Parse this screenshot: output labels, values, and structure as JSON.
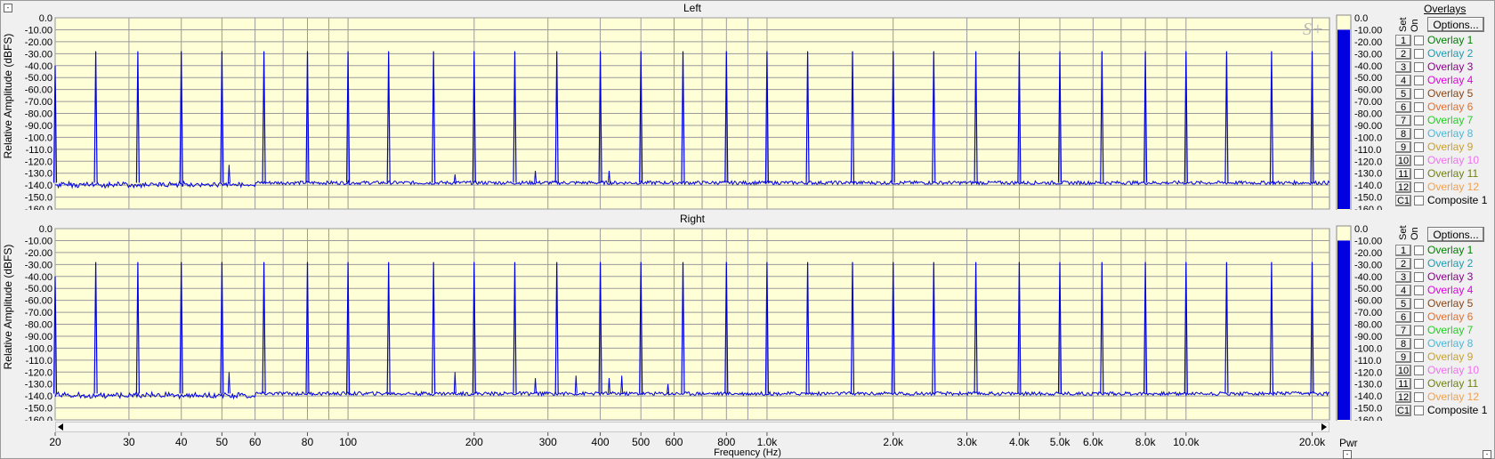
{
  "window": {
    "corner_tl": "-",
    "corner_br": "-",
    "corner_bl": "-"
  },
  "panels": [
    {
      "title": "Left"
    },
    {
      "title": "Right"
    }
  ],
  "ylabel": "Relative Amplitude (dBFS)",
  "xlabel": "Frequency (Hz)",
  "logo": "S+",
  "pwr_label": "Pwr",
  "overlays": {
    "header": "Overlays",
    "set_label": "Set",
    "on_label": "On",
    "options_label": "Options...",
    "items": [
      {
        "set": "1",
        "label": "Overlay 1",
        "color": "#008000"
      },
      {
        "set": "2",
        "label": "Overlay 2",
        "color": "#1e9bb0"
      },
      {
        "set": "3",
        "label": "Overlay 3",
        "color": "#8b008b"
      },
      {
        "set": "4",
        "label": "Overlay 4",
        "color": "#e000e0"
      },
      {
        "set": "5",
        "label": "Overlay 5",
        "color": "#8b4513"
      },
      {
        "set": "6",
        "label": "Overlay 6",
        "color": "#e07030"
      },
      {
        "set": "7",
        "label": "Overlay 7",
        "color": "#20d020"
      },
      {
        "set": "8",
        "label": "Overlay 8",
        "color": "#4ab8d8"
      },
      {
        "set": "9",
        "label": "Overlay 9",
        "color": "#c8a030"
      },
      {
        "set": "10",
        "label": "Overlay 10",
        "color": "#f070f0"
      },
      {
        "set": "11",
        "label": "Overlay 11",
        "color": "#708010"
      },
      {
        "set": "12",
        "label": "Overlay 12",
        "color": "#f0a050"
      },
      {
        "set": "C1",
        "label": "Composite 1",
        "color": "#000000"
      }
    ]
  },
  "colors": {
    "plot_bg": "#ffffd7",
    "trace": "#0000e0",
    "grid": "#9a9a9a",
    "pwr_bar": "#0000e0"
  },
  "chart_data": [
    {
      "type": "line",
      "title": "Left",
      "ylabel": "Relative Amplitude (dBFS)",
      "xlabel": "Frequency (Hz)",
      "xscale": "log",
      "xlim": [
        20,
        22000
      ],
      "ylim": [
        -160,
        0
      ],
      "grid": true,
      "y_ticks": [
        "0.0",
        "-10.00",
        "-20.00",
        "-30.00",
        "-40.00",
        "-50.00",
        "-60.00",
        "-70.00",
        "-80.00",
        "-90.00",
        "-100.0",
        "-110.0",
        "-120.0",
        "-130.0",
        "-140.0",
        "-150.0",
        "-160.0"
      ],
      "x_ticks": [
        {
          "v": 20,
          "t": "20"
        },
        {
          "v": 30,
          "t": "30"
        },
        {
          "v": 40,
          "t": "40"
        },
        {
          "v": 50,
          "t": "50"
        },
        {
          "v": 60,
          "t": "60"
        },
        {
          "v": 80,
          "t": "80"
        },
        {
          "v": 100,
          "t": "100"
        },
        {
          "v": 200,
          "t": "200"
        },
        {
          "v": 300,
          "t": "300"
        },
        {
          "v": 400,
          "t": "400"
        },
        {
          "v": 500,
          "t": "500"
        },
        {
          "v": 600,
          "t": "600"
        },
        {
          "v": 800,
          "t": "800"
        },
        {
          "v": 1000,
          "t": "1.0k"
        },
        {
          "v": 2000,
          "t": "2.0k"
        },
        {
          "v": 3000,
          "t": "3.0k"
        },
        {
          "v": 4000,
          "t": "4.0k"
        },
        {
          "v": 5000,
          "t": "5.0k"
        },
        {
          "v": 6000,
          "t": "6.0k"
        },
        {
          "v": 8000,
          "t": "8.0k"
        },
        {
          "v": 10000,
          "t": "10.0k"
        },
        {
          "v": 20000,
          "t": "20.0k"
        }
      ],
      "noise_floor_db": -138,
      "peaks": [
        {
          "f": 20,
          "db": -40
        },
        {
          "f": 25,
          "db": -28
        },
        {
          "f": 31.5,
          "db": -28
        },
        {
          "f": 40,
          "db": -28
        },
        {
          "f": 50,
          "db": -28
        },
        {
          "f": 63,
          "db": -28
        },
        {
          "f": 80,
          "db": -28
        },
        {
          "f": 100,
          "db": -28
        },
        {
          "f": 125,
          "db": -28
        },
        {
          "f": 160,
          "db": -28
        },
        {
          "f": 200,
          "db": -28
        },
        {
          "f": 250,
          "db": -28
        },
        {
          "f": 315,
          "db": -28
        },
        {
          "f": 400,
          "db": -28
        },
        {
          "f": 500,
          "db": -28
        },
        {
          "f": 630,
          "db": -28
        },
        {
          "f": 800,
          "db": -28
        },
        {
          "f": 1000,
          "db": -28
        },
        {
          "f": 1250,
          "db": -28
        },
        {
          "f": 1600,
          "db": -28
        },
        {
          "f": 2000,
          "db": -28
        },
        {
          "f": 2500,
          "db": -28
        },
        {
          "f": 3150,
          "db": -28
        },
        {
          "f": 4000,
          "db": -28
        },
        {
          "f": 5000,
          "db": -28
        },
        {
          "f": 6300,
          "db": -28
        },
        {
          "f": 8000,
          "db": -28
        },
        {
          "f": 10000,
          "db": -28
        },
        {
          "f": 12500,
          "db": -28
        },
        {
          "f": 16000,
          "db": -28
        },
        {
          "f": 20000,
          "db": -28
        }
      ],
      "spurs": [
        {
          "f": 52,
          "db": -123
        },
        {
          "f": 180,
          "db": -131
        },
        {
          "f": 280,
          "db": -128
        },
        {
          "f": 420,
          "db": -128
        }
      ]
    },
    {
      "type": "line",
      "title": "Right",
      "ylabel": "Relative Amplitude (dBFS)",
      "xlabel": "Frequency (Hz)",
      "xscale": "log",
      "xlim": [
        20,
        22000
      ],
      "ylim": [
        -160,
        0
      ],
      "grid": true,
      "y_ticks": [
        "0.0",
        "-10.00",
        "-20.00",
        "-30.00",
        "-40.00",
        "-50.00",
        "-60.00",
        "-70.00",
        "-80.00",
        "-90.00",
        "-100.0",
        "-110.0",
        "-120.0",
        "-130.0",
        "-140.0",
        "-150.0",
        "-160.0"
      ],
      "x_ticks": [
        {
          "v": 20,
          "t": "20"
        },
        {
          "v": 30,
          "t": "30"
        },
        {
          "v": 40,
          "t": "40"
        },
        {
          "v": 50,
          "t": "50"
        },
        {
          "v": 60,
          "t": "60"
        },
        {
          "v": 80,
          "t": "80"
        },
        {
          "v": 100,
          "t": "100"
        },
        {
          "v": 200,
          "t": "200"
        },
        {
          "v": 300,
          "t": "300"
        },
        {
          "v": 400,
          "t": "400"
        },
        {
          "v": 500,
          "t": "500"
        },
        {
          "v": 600,
          "t": "600"
        },
        {
          "v": 800,
          "t": "800"
        },
        {
          "v": 1000,
          "t": "1.0k"
        },
        {
          "v": 2000,
          "t": "2.0k"
        },
        {
          "v": 3000,
          "t": "3.0k"
        },
        {
          "v": 4000,
          "t": "4.0k"
        },
        {
          "v": 5000,
          "t": "5.0k"
        },
        {
          "v": 6000,
          "t": "6.0k"
        },
        {
          "v": 8000,
          "t": "8.0k"
        },
        {
          "v": 10000,
          "t": "10.0k"
        },
        {
          "v": 20000,
          "t": "20.0k"
        }
      ],
      "noise_floor_db": -138,
      "peaks": [
        {
          "f": 20,
          "db": -40
        },
        {
          "f": 25,
          "db": -28
        },
        {
          "f": 31.5,
          "db": -28
        },
        {
          "f": 40,
          "db": -28
        },
        {
          "f": 50,
          "db": -28
        },
        {
          "f": 63,
          "db": -28
        },
        {
          "f": 80,
          "db": -28
        },
        {
          "f": 100,
          "db": -28
        },
        {
          "f": 125,
          "db": -28
        },
        {
          "f": 160,
          "db": -28
        },
        {
          "f": 200,
          "db": -28
        },
        {
          "f": 250,
          "db": -28
        },
        {
          "f": 315,
          "db": -28
        },
        {
          "f": 400,
          "db": -28
        },
        {
          "f": 500,
          "db": -28
        },
        {
          "f": 630,
          "db": -28
        },
        {
          "f": 800,
          "db": -28
        },
        {
          "f": 1000,
          "db": -28
        },
        {
          "f": 1250,
          "db": -28
        },
        {
          "f": 1600,
          "db": -28
        },
        {
          "f": 2000,
          "db": -28
        },
        {
          "f": 2500,
          "db": -28
        },
        {
          "f": 3150,
          "db": -28
        },
        {
          "f": 4000,
          "db": -28
        },
        {
          "f": 5000,
          "db": -28
        },
        {
          "f": 6300,
          "db": -28
        },
        {
          "f": 8000,
          "db": -28
        },
        {
          "f": 10000,
          "db": -28
        },
        {
          "f": 12500,
          "db": -28
        },
        {
          "f": 16000,
          "db": -28
        },
        {
          "f": 20000,
          "db": -28
        }
      ],
      "spurs": [
        {
          "f": 52,
          "db": -120
        },
        {
          "f": 180,
          "db": -120
        },
        {
          "f": 280,
          "db": -125
        },
        {
          "f": 350,
          "db": -123
        },
        {
          "f": 420,
          "db": -125
        },
        {
          "f": 450,
          "db": -123
        },
        {
          "f": 580,
          "db": -130
        }
      ]
    }
  ],
  "pwr": [
    {
      "ticks": [
        "0.0",
        "-10.00",
        "-20.00",
        "-30.00",
        "-40.00",
        "-50.00",
        "-60.00",
        "-70.00",
        "-80.00",
        "-90.00",
        "-100.0",
        "-110.0",
        "-120.0",
        "-130.0",
        "-140.0",
        "-150.0",
        "-160.0"
      ],
      "level_db": -10
    },
    {
      "ticks": [
        "0.0",
        "-10.00",
        "-20.00",
        "-30.00",
        "-40.00",
        "-50.00",
        "-60.00",
        "-70.00",
        "-80.00",
        "-90.00",
        "-100.0",
        "-110.0",
        "-120.0",
        "-130.0",
        "-140.0",
        "-150.0",
        "-160.0"
      ],
      "level_db": -10
    }
  ]
}
